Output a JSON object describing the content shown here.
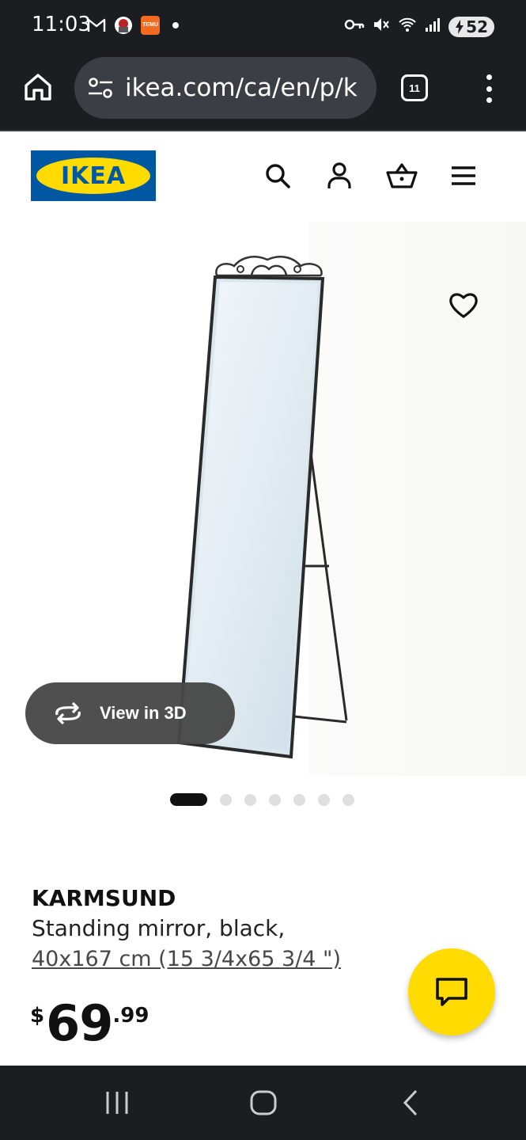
{
  "status_bar": {
    "time": "11:03",
    "battery": "52",
    "icons": [
      "gmail-icon",
      "avatar-icon",
      "temu-icon",
      "notification-dot",
      "vpn-key-icon",
      "mute-icon",
      "wifi-icon",
      "signal-icon",
      "battery-icon"
    ],
    "temu_label": "TEMU"
  },
  "browser": {
    "url": "ikea.com/ca/en/p/k",
    "tab_count": "11"
  },
  "header": {
    "logo_text": "IKEA",
    "logo_registered": "®",
    "icons": [
      "search-icon",
      "account-icon",
      "cart-icon",
      "hamburger-menu-icon"
    ],
    "colors": {
      "brand_blue": "#0058a3",
      "brand_yellow": "#ffdb00"
    }
  },
  "gallery": {
    "view_3d_label": "View in 3D",
    "image_count": 7,
    "active_index": 0
  },
  "product": {
    "name": "KARMSUND",
    "description": "Standing mirror, black,",
    "size": "40x167 cm (15 3/4x65 3/4 \")",
    "price_currency": "$",
    "price_integer": "69",
    "price_decimal": ".99"
  },
  "chat": {
    "icon": "chat-icon"
  },
  "nav_bar": {
    "items": [
      "recent-apps-icon",
      "home-icon",
      "back-icon"
    ]
  }
}
